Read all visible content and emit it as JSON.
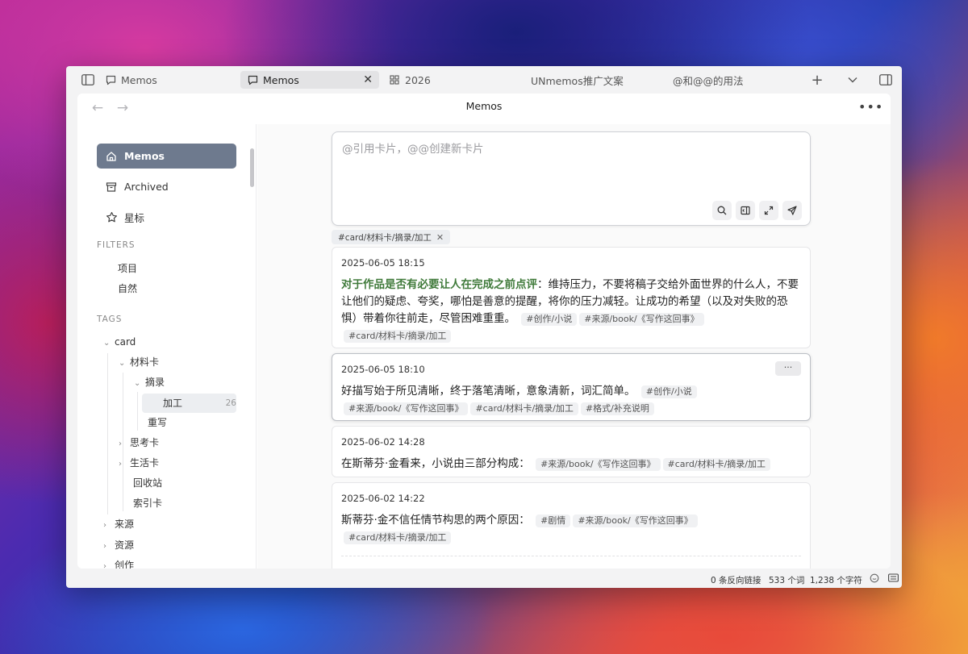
{
  "tabs": [
    {
      "label": "Memos",
      "icon": "memo-icon",
      "active": false
    },
    {
      "label": "Memos",
      "icon": "memo-icon",
      "active": true
    },
    {
      "label": "2026",
      "icon": "grid-icon",
      "active": false
    },
    {
      "label": "UNmemos推广文案",
      "icon": "",
      "active": false
    },
    {
      "label": "@和@@的用法",
      "icon": "",
      "active": false
    }
  ],
  "navbar": {
    "title": "Memos"
  },
  "sidebar": {
    "items": [
      {
        "label": "Memos",
        "icon": "home-icon"
      },
      {
        "label": "Archived",
        "icon": "archive-icon"
      },
      {
        "label": "星标",
        "icon": "star-icon"
      }
    ],
    "filters_label": "FILTERS",
    "filters": [
      "项目",
      "自然"
    ],
    "tags_label": "TAGS",
    "tree": [
      {
        "label": "card"
      },
      {
        "label": "材料卡"
      },
      {
        "label": "摘录"
      },
      {
        "label": "加工",
        "count": "26"
      },
      {
        "label": "重写"
      },
      {
        "label": "思考卡"
      },
      {
        "label": "生活卡"
      },
      {
        "label": "回收站"
      },
      {
        "label": "索引卡"
      },
      {
        "label": "来源"
      },
      {
        "label": "资源"
      },
      {
        "label": "创作"
      }
    ]
  },
  "editor": {
    "placeholder": "@引用卡片，@@创建新卡片"
  },
  "filter_chip": "#card/材料卡/摘录/加工",
  "cards": [
    {
      "date": "2025-06-05 18:15",
      "highlight": "对于作品是否有必要让人在完成之前点评",
      "text": "：维持压力，不要将稿子交给外面世界的什么人，不要让他们的疑虑、夸奖，哪怕是善意的提醒，将你的压力减轻。让成功的希望（以及对失败的恐惧）带着你往前走，尽管困难重重。",
      "tags": [
        "#创作/小说",
        "#来源/book/《写作这回事》",
        "#card/材料卡/摘录/加工"
      ]
    },
    {
      "date": "2025-06-05 18:10",
      "text": "好描写始于所见清晰，终于落笔清晰，意象清新，词汇简单。",
      "tags": [
        "#创作/小说",
        "#来源/book/《写作这回事》",
        "#card/材料卡/摘录/加工",
        "#格式/补充说明"
      ],
      "more": "···"
    },
    {
      "date": "2025-06-02 14:28",
      "text": "在斯蒂芬·金看来，小说由三部分构成：",
      "tags": [
        "#来源/book/《写作这回事》",
        "#card/材料卡/摘录/加工"
      ]
    },
    {
      "date": "2025-06-02 14:22",
      "text": "斯蒂芬·金不信任情节构思的两个原因：",
      "tags": [
        "#剧情",
        "#来源/book/《写作这回事》",
        "#card/材料卡/摘录/加工"
      ]
    }
  ],
  "status": {
    "backlinks": "0 条反向链接",
    "words": "533 个词",
    "chars": "1,238 个字符"
  }
}
